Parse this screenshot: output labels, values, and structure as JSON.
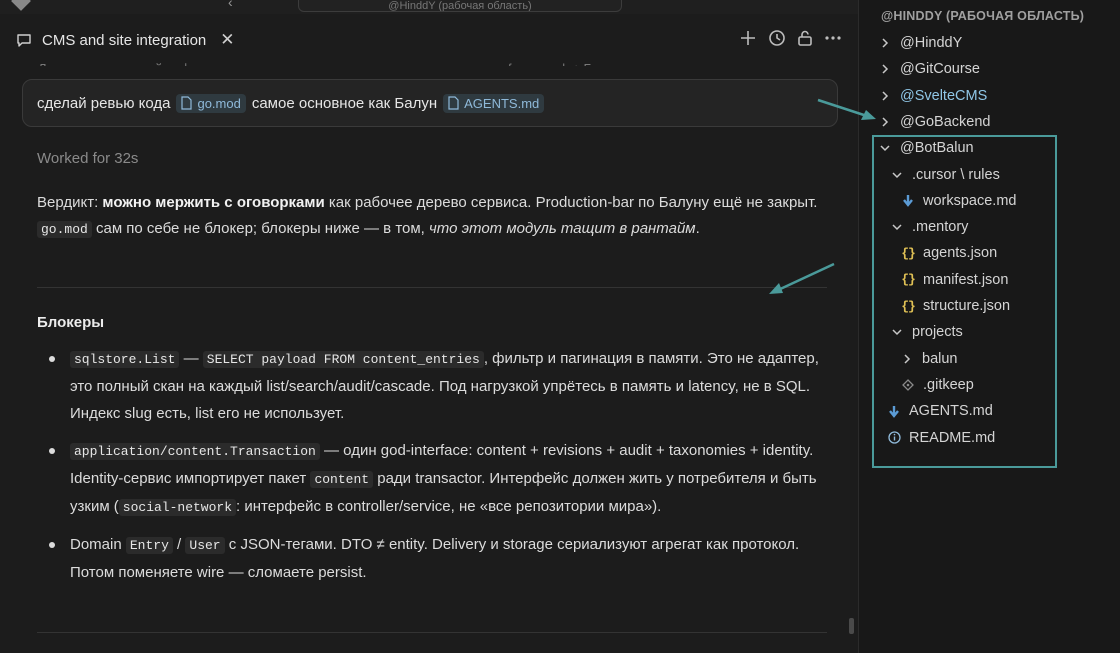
{
  "window": {
    "title_field": "@HinddY (рабочая область)"
  },
  "chat": {
    "tab": {
      "label": "CMS and site integration"
    },
    "cutoff_text": "Лучше всего полный рефакторинг с удалением лишнего, того, что уже есть в framework + Балун",
    "user_message": {
      "text_before": "сделай ревью кода",
      "chip1": "go.mod",
      "text_mid": "самое основное как Балун",
      "chip2": "AGENTS.md"
    },
    "worked_for": "Worked for 32s",
    "verdict": {
      "prefix": "Вердикт: ",
      "bold": "можно мержить с оговорками",
      "rest1": " как рабочее дерево сервиса. Production-bar по Балуну ещё не закрыт. ",
      "code": "go.mod",
      "rest2": " сам по себе не блокер; блокеры ниже — в том, ",
      "italic": "что этот модуль тащит в рантайм",
      "end": "."
    },
    "blockers_heading": "Блокеры",
    "blockers": [
      {
        "code1": "sqlstore.List",
        "t1": " — ",
        "code2": "SELECT payload FROM content_entries",
        "t2": ", фильтр и пагинация в памяти. Это не адаптер, это полный скан на каждый list/search/audit/cascade. Под нагрузкой упрётесь в память и latency, не в SQL. Индекс slug есть, list его не использует."
      },
      {
        "code1": "application/content.Transaction",
        "t1": " — один god-interface: content + revisions + audit + taxonomies + identity. Identity-сервис импортирует пакет ",
        "code2": "content",
        "t2": " ради transactor. Интерфейс должен жить у потребителя и быть узким (",
        "code3": "social-network",
        "t3": ": интерфейс в controller/service, не «все репозитории мира»)."
      },
      {
        "t0": "Domain ",
        "code1": "Entry",
        "t1": " / ",
        "code2": "User",
        "t2": " с JSON-тегами. DTO ≠ entity. Delivery и storage сериализуют агрегат как протокол. Потом поменяете wire — сломаете persist."
      }
    ]
  },
  "explorer": {
    "workspace_title": "@HINDDY (РАБОЧАЯ ОБЛАСТЬ)",
    "items": [
      {
        "label": "@HinddY",
        "kind": "folder",
        "state": "collapsed"
      },
      {
        "label": "@GitCourse",
        "kind": "folder",
        "state": "collapsed"
      },
      {
        "label": "@SvelteCMS",
        "kind": "folder",
        "state": "collapsed",
        "color": "#8fc6e6"
      },
      {
        "label": "@GoBackend",
        "kind": "folder",
        "state": "collapsed"
      },
      {
        "label": "@BotBalun",
        "kind": "folder",
        "state": "expanded"
      },
      {
        "label": ".cursor \\ rules",
        "kind": "folder",
        "state": "expanded"
      },
      {
        "label": "workspace.md",
        "kind": "markdown"
      },
      {
        "label": ".mentory",
        "kind": "folder",
        "state": "expanded"
      },
      {
        "label": "agents.json",
        "kind": "json"
      },
      {
        "label": "manifest.json",
        "kind": "json"
      },
      {
        "label": "structure.json",
        "kind": "json"
      },
      {
        "label": "projects",
        "kind": "folder",
        "state": "expanded"
      },
      {
        "label": "balun",
        "kind": "folder",
        "state": "collapsed"
      },
      {
        "label": ".gitkeep",
        "kind": "gitkeep"
      },
      {
        "label": "AGENTS.md",
        "kind": "markdown"
      },
      {
        "label": "README.md",
        "kind": "info"
      }
    ]
  },
  "colors": {
    "accent_teal": "#4a9a9a",
    "json_icon": "#e0c155",
    "markdown_icon": "#5b9bd5",
    "chip_text": "#8fb9d9"
  }
}
